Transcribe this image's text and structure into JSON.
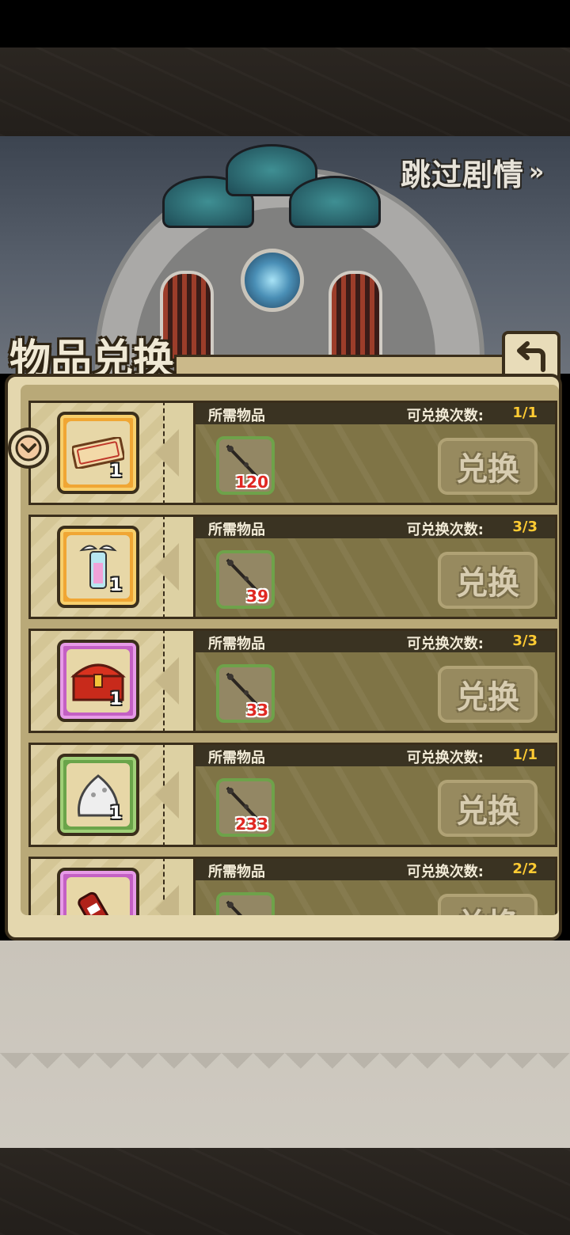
{
  "header": {
    "skip_label": "跳过剧情",
    "skip_arrows": "»"
  },
  "panel": {
    "title": "物品兑换"
  },
  "rows": [
    {
      "required_label": "所需物品",
      "count_label": "可兑换次数:",
      "count_value": "1/1",
      "reward_qty": "1",
      "reward_icon": "ticket-icon",
      "reward_tier": "orange",
      "cost_icon": "staff-icon",
      "cost_qty": "120",
      "button_label": "兑换"
    },
    {
      "required_label": "所需物品",
      "count_label": "可兑换次数:",
      "count_value": "3/3",
      "reward_qty": "1",
      "reward_icon": "winged-lantern-icon",
      "reward_tier": "orange",
      "cost_icon": "staff-icon",
      "cost_qty": "39",
      "button_label": "兑换"
    },
    {
      "required_label": "所需物品",
      "count_label": "可兑换次数:",
      "count_value": "3/3",
      "reward_qty": "1",
      "reward_icon": "treasure-chest-icon",
      "reward_tier": "pink",
      "cost_icon": "staff-icon",
      "cost_qty": "33",
      "button_label": "兑换"
    },
    {
      "required_label": "所需物品",
      "count_label": "可兑换次数:",
      "count_value": "1/1",
      "reward_qty": "1",
      "reward_icon": "slime-icon",
      "reward_tier": "green",
      "cost_icon": "staff-icon",
      "cost_qty": "233",
      "button_label": "兑换"
    },
    {
      "required_label": "所需物品",
      "count_label": "可兑换次数:",
      "count_value": "2/2",
      "reward_qty": "",
      "reward_icon": "bottle-icon",
      "reward_tier": "pink",
      "cost_icon": "staff-icon",
      "cost_qty": "",
      "button_label": "兑换"
    }
  ],
  "colors": {
    "count_value": "#ffcb33",
    "cost_qty": "#e02822",
    "panel_bg": "#e4d7ae",
    "row_right_bg": "#7f7446"
  }
}
